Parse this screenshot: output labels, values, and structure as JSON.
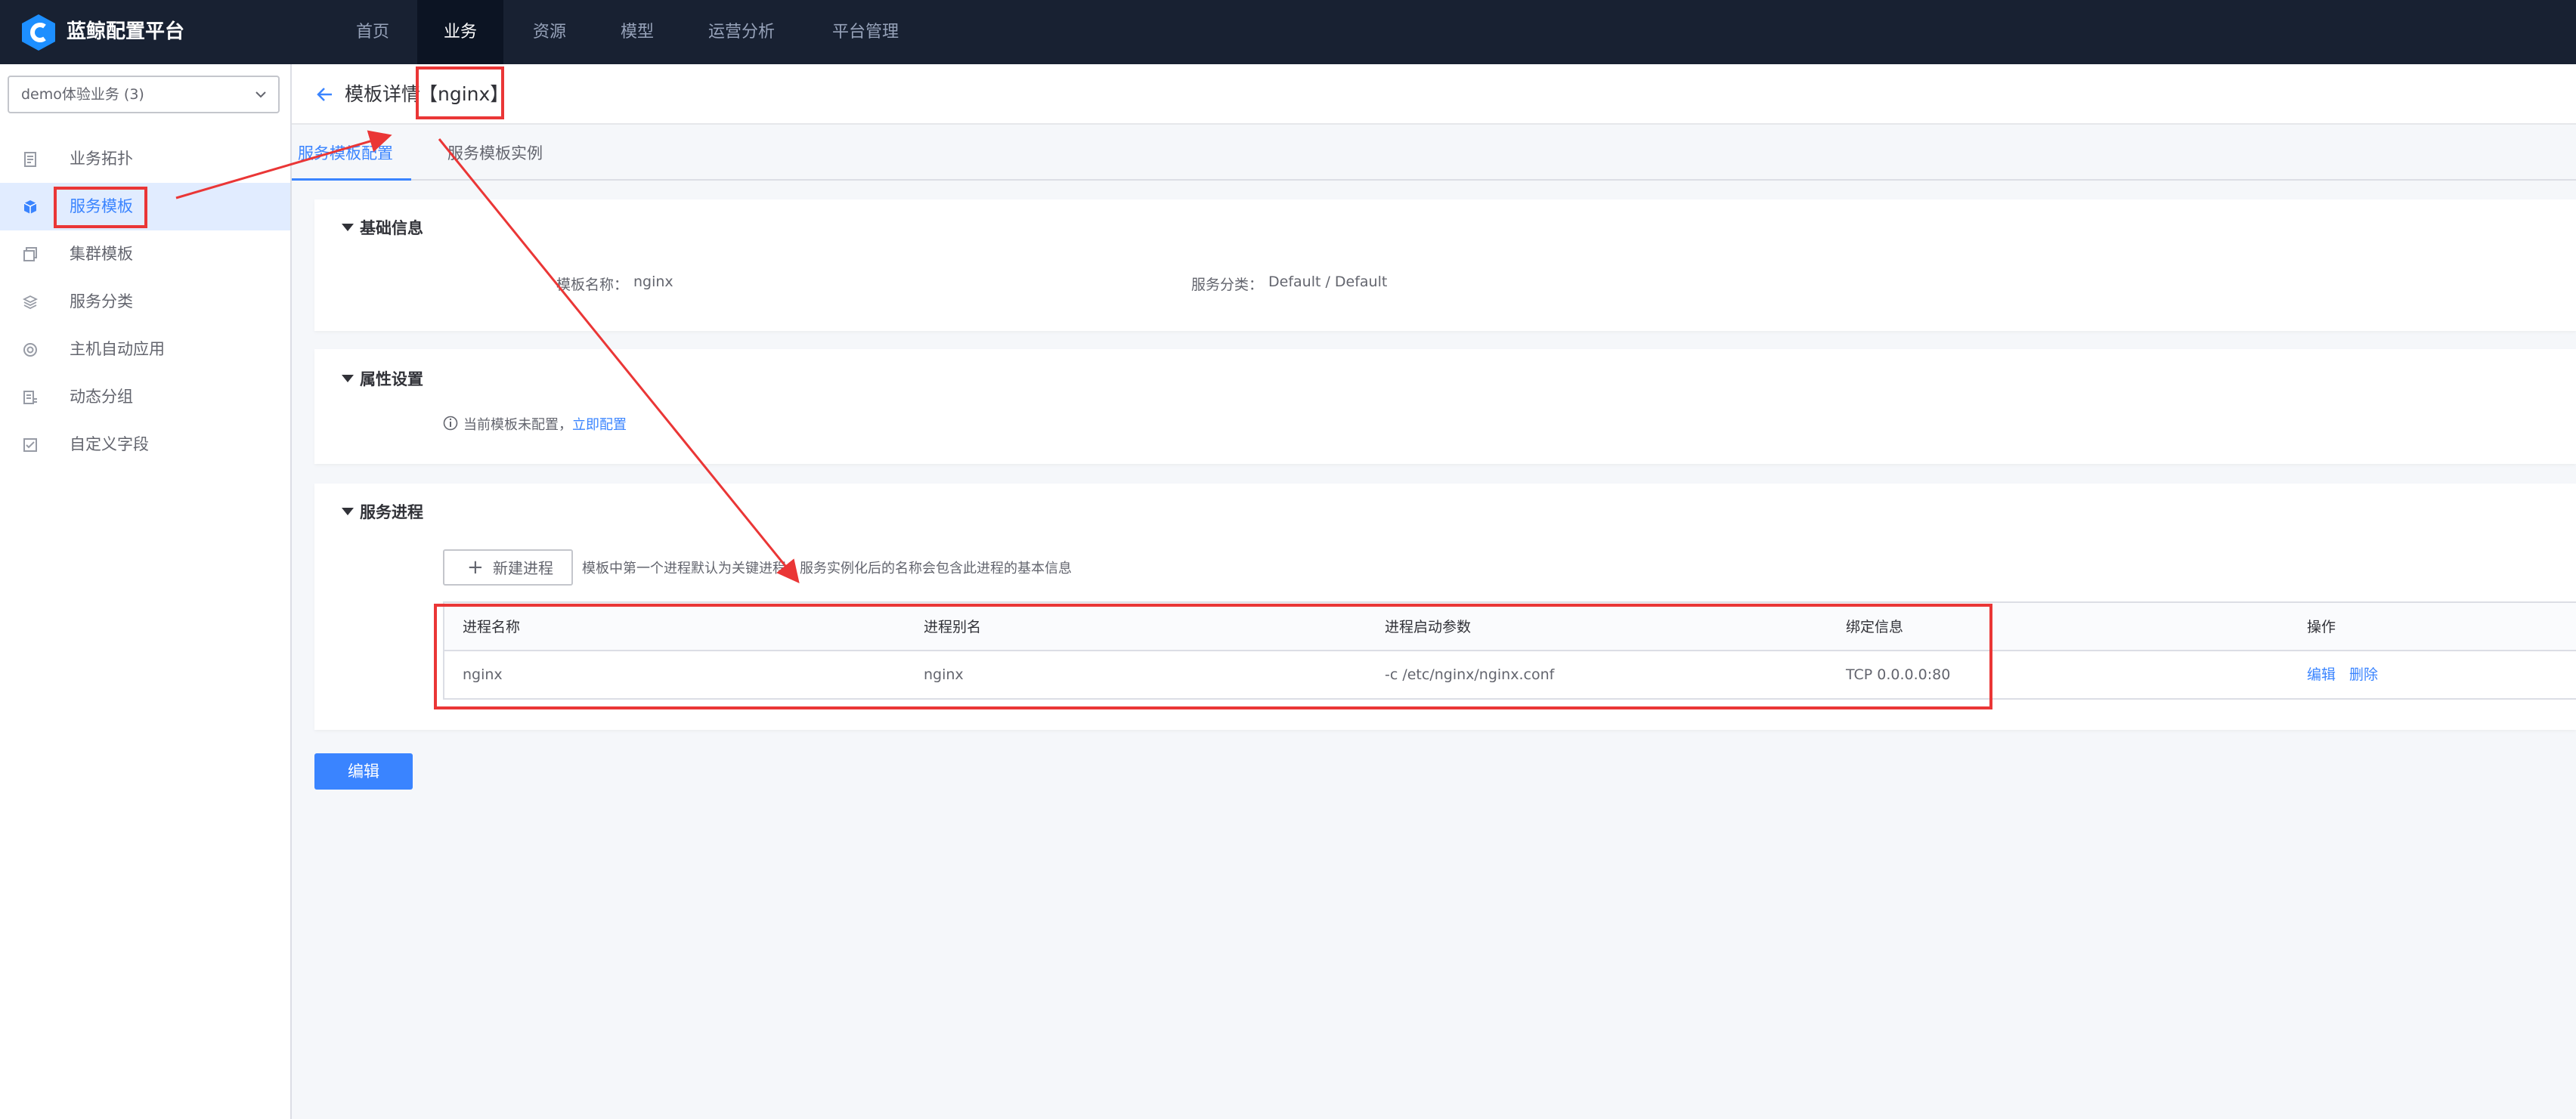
{
  "topbar": {
    "brand": "蓝鲸配置平台",
    "nav": [
      {
        "label": "首页"
      },
      {
        "label": "业务"
      },
      {
        "label": "资源"
      },
      {
        "label": "模型"
      },
      {
        "label": "运营分析"
      },
      {
        "label": "平台管理"
      }
    ],
    "active_index": 1
  },
  "sidebar": {
    "business_select": "demo体验业务 (3)",
    "items": [
      {
        "label": "业务拓扑",
        "icon": "document-icon"
      },
      {
        "label": "服务模板",
        "icon": "cube-icon"
      },
      {
        "label": "集群模板",
        "icon": "stack-icon"
      },
      {
        "label": "服务分类",
        "icon": "layers-icon"
      },
      {
        "label": "主机自动应用",
        "icon": "target-icon"
      },
      {
        "label": "动态分组",
        "icon": "list-icon"
      },
      {
        "label": "自定义字段",
        "icon": "checklist-icon"
      }
    ],
    "active_index": 1
  },
  "header": {
    "title": "模板详情",
    "tag": "【nginx】"
  },
  "tabs": [
    {
      "label": "服务模板配置"
    },
    {
      "label": "服务模板实例"
    }
  ],
  "basic_info": {
    "title": "基础信息",
    "name_label": "模板名称：",
    "name_value": "nginx",
    "category_label": "服务分类：",
    "category_value": "Default / Default"
  },
  "attributes": {
    "title": "属性设置",
    "hint": "当前模板未配置，",
    "link": "立即配置"
  },
  "processes": {
    "title": "服务进程",
    "new_button": "新建进程",
    "hint": "模板中第一个进程默认为关键进程，服务实例化后的名称会包含此进程的基本信息",
    "columns": [
      "进程名称",
      "进程别名",
      "进程启动参数",
      "绑定信息",
      "操作"
    ],
    "rows": [
      {
        "name": "nginx",
        "alias": "nginx",
        "args": "-c /etc/nginx/nginx.conf",
        "bind": "TCP 0.0.0.0:80",
        "edit": "编辑",
        "delete": "删除"
      }
    ]
  },
  "edit_button": "编辑",
  "colors": {
    "topbar": "#182132",
    "accent": "#3a84ff",
    "annotation": "#ea3636"
  }
}
